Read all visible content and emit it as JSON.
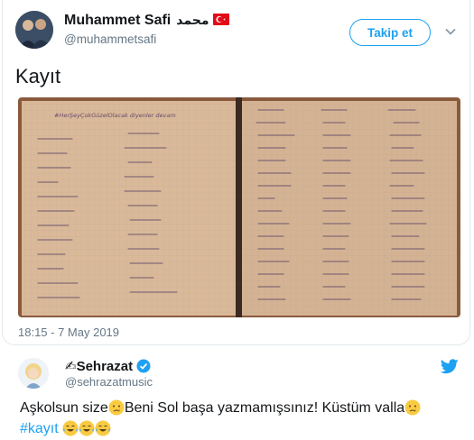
{
  "tweet": {
    "author_name": "Muhammet Safi",
    "author_name_arabic": "محمد",
    "author_flag": "turkey-flag-icon",
    "author_handle": "@muhammetsafi",
    "follow_label": "Takip et",
    "text": "Kayıt",
    "timestamp": "18:15 - 7 May 2019",
    "photo": {
      "description_icon": "notebook-photo",
      "page_heading": "#HerŞeyÇokGüzelOlacak diyenler devam"
    }
  },
  "quote": {
    "author_name": "✍Sehrazat",
    "author_handle": "@sehrazatmusic",
    "text_part1": "Aşkolsun size",
    "text_part2": "Beni Sol başa yazmamışsınız! Küstüm valla",
    "hashtag": "#kayıt",
    "verified": true
  },
  "colors": {
    "accent": "#1da1f2",
    "muted": "#657786",
    "border": "#e1e8ed"
  }
}
